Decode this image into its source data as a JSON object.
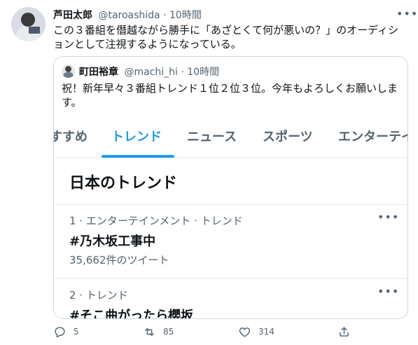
{
  "tweet": {
    "author_name": "芦田太郎",
    "author_handle": "@taroashida",
    "time": "10時間",
    "text": "この３番組を僭越ながら勝手に「あざとくて何が悪いの？」のオーディションとして注視するようになっている。"
  },
  "quote": {
    "author_name": "町田裕章",
    "author_handle": "@machi_hi",
    "time": "10時間",
    "text": "祝！新年早々３番組トレンド１位２位３位。今年もよろしくお願いします。",
    "screenshot": {
      "tabs": [
        "すすめ",
        "トレンド",
        "ニュース",
        "スポーツ",
        "エンターテイ"
      ],
      "active_tab": "トレンド",
      "section_title": "日本のトレンド",
      "trends": [
        {
          "context": "1 · エンターテインメント · トレンド",
          "name": "#乃木坂工事中",
          "count": "35,662件のツイート"
        },
        {
          "context": "2 · トレンド",
          "name": "#そこ曲がったら櫻坂",
          "count": ""
        }
      ]
    }
  },
  "actions": {
    "reply_count": "5",
    "retweet_count": "85",
    "like_count": "314"
  }
}
